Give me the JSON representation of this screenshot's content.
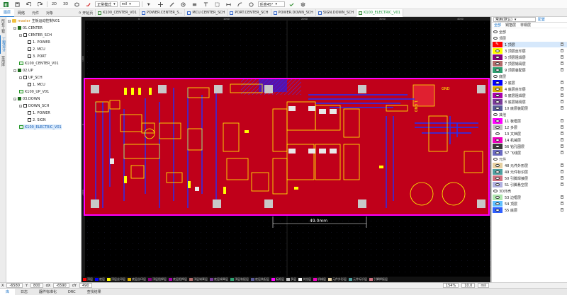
{
  "toolbar": {
    "view_2d": "2D",
    "view_3d": "3D",
    "mode_select": "正常模式",
    "unit_select": "mil",
    "angle_select": "任意45°"
  },
  "left_tabs": [
    "图层",
    "网络",
    "元件",
    "对象"
  ],
  "doc_tabs": [
    {
      "label": "开始页",
      "kind": "home"
    },
    {
      "label": "K100_CENTER_V01",
      "kind": "pcb"
    },
    {
      "label": "POWER.CENTER_S...",
      "kind": "sch"
    },
    {
      "label": "MCU.CENTER_SCH",
      "kind": "sch"
    },
    {
      "label": "PORT.CENTER_SCH",
      "kind": "sch"
    },
    {
      "label": "POWER.DOWN_SCH",
      "kind": "sch"
    },
    {
      "label": "SIGN.DOWN_SCH",
      "kind": "sch"
    },
    {
      "label": "K100_ELECTRIC_V01",
      "kind": "pcb",
      "active": true
    }
  ],
  "side_vtabs": [
    "所有工程",
    "工程设计",
    "常用库"
  ],
  "tree": [
    {
      "label": "主板运动控制V01",
      "kind": "root",
      "prefix": "master"
    },
    {
      "label": "01.CENTER",
      "kind": "board"
    },
    {
      "label": "CENTER_SCH",
      "kind": "schfolder"
    },
    {
      "label": "1. POWER",
      "kind": "page"
    },
    {
      "label": "2. MCU",
      "kind": "page"
    },
    {
      "label": "3. PORT",
      "kind": "page"
    },
    {
      "label": "K100_CENTER_V01",
      "kind": "pcb"
    },
    {
      "label": "02.UP",
      "kind": "board"
    },
    {
      "label": "UP_SCH",
      "kind": "schfolder"
    },
    {
      "label": "1. MCU",
      "kind": "page"
    },
    {
      "label": "K100_UP_V01",
      "kind": "pcb"
    },
    {
      "label": "03.DOWN",
      "kind": "board"
    },
    {
      "label": "DOWN_SCH",
      "kind": "schfolder"
    },
    {
      "label": "1. POWER",
      "kind": "page"
    },
    {
      "label": "2. SIGN",
      "kind": "page"
    },
    {
      "label": "K100_ELECTRIC_V01",
      "kind": "pcb",
      "selected": true
    }
  ],
  "layers_panel": {
    "preset": "常用(默认)",
    "manage": "配置",
    "filter_tabs": [
      "全部",
      "铜箔层",
      "非铜层"
    ],
    "group_all": "全部",
    "groups": [
      {
        "name": "顶层",
        "items": [
          {
            "name": "1 顶层",
            "color": "#ff0000",
            "selected": true
          },
          {
            "name": "3 顶层丝印层",
            "color": "#ffff00"
          },
          {
            "name": "5 顶层阻焊层",
            "color": "#8b0080"
          },
          {
            "name": "7 顶层锡膏层",
            "color": "#b36b6b"
          },
          {
            "name": "9 顶层装配层",
            "color": "#2ea070"
          }
        ]
      },
      {
        "name": "底层",
        "items": [
          {
            "name": "2 底层",
            "color": "#0000ff"
          },
          {
            "name": "4 底层丝印层",
            "color": "#d8b000"
          },
          {
            "name": "6 底层阻焊层",
            "color": "#aa00aa"
          },
          {
            "name": "8 底层锡膏层",
            "color": "#7a3a9a"
          },
          {
            "name": "10 底层装配层",
            "color": "#5a5a9a"
          }
        ]
      },
      {
        "name": "其他",
        "items": [
          {
            "name": "11 板框层",
            "color": "#ff00ff"
          },
          {
            "name": "12 多层",
            "color": "#c0c0c0"
          },
          {
            "name": "13 文档层",
            "color": "#ffffff"
          },
          {
            "name": "14 机械层",
            "color": "#f000c0"
          },
          {
            "name": "56 钻孔图层",
            "color": "#3a3a3a"
          },
          {
            "name": "57 飞线层",
            "color": "#6a6ac0"
          }
        ]
      },
      {
        "name": "元件",
        "items": [
          {
            "name": "48 元件外形层",
            "color": "#e6d0a0"
          },
          {
            "name": "49 元件标识层",
            "color": "#4ea0a0"
          },
          {
            "name": "50 引脚焊接层",
            "color": "#d07080"
          },
          {
            "name": "51 引脚悬空层",
            "color": "#b0b0e0"
          }
        ]
      },
      {
        "name": "3D外壳",
        "items": [
          {
            "name": "53 边框层",
            "color": "#b0e8b0"
          },
          {
            "name": "54 顶层",
            "color": "#60c0ff"
          },
          {
            "name": "55 底层",
            "color": "#3060ff"
          }
        ]
      }
    ]
  },
  "layer_bar": [
    {
      "name": "顶层",
      "color": "#ff0000"
    },
    {
      "name": "底层",
      "color": "#0000ff"
    },
    {
      "name": "顶层丝印层",
      "color": "#ffff00"
    },
    {
      "name": "底层丝印层",
      "color": "#d8b000"
    },
    {
      "name": "顶层阻焊层",
      "color": "#8b0080"
    },
    {
      "name": "底层阻焊层",
      "color": "#aa00aa"
    },
    {
      "name": "顶层锡膏层",
      "color": "#b36b6b"
    },
    {
      "name": "底层锡膏层",
      "color": "#7a3a9a"
    },
    {
      "name": "顶层装配层",
      "color": "#2ea070"
    },
    {
      "name": "底层装配层",
      "color": "#5a5a9a"
    },
    {
      "name": "板框层",
      "color": "#ff00ff"
    },
    {
      "name": "多层",
      "color": "#c0c0c0"
    },
    {
      "name": "文档层",
      "color": "#ffffff"
    },
    {
      "name": "机械层",
      "color": "#f000c0"
    },
    {
      "name": "元件外形层",
      "color": "#e6d0a0"
    },
    {
      "name": "元件标识层",
      "color": "#4ea0a0"
    },
    {
      "name": "引脚焊接层",
      "color": "#d07080"
    }
  ],
  "ruler": {
    "top_ticks": [
      "0",
      "1000",
      "2000",
      "3000",
      "4000"
    ],
    "left_ticks": [
      "1000",
      "0",
      "-1000"
    ]
  },
  "dimension_label": "49.0mm",
  "board_labels": {
    "gnd": "GND",
    "jumper": "1 GND"
  },
  "status": {
    "x_label": "X",
    "x_value": "-6580",
    "y_label": "Y",
    "y_value": "800",
    "dx_label": "dX",
    "dx_value": "-6590",
    "dy_label": "dY",
    "dy_value": "490",
    "zoom": "154%",
    "grid": "10.0",
    "unit": "mil"
  },
  "bottom_tabs": [
    "库",
    "日志",
    "器件标准化",
    "DRC",
    "查找结果"
  ],
  "colors": {
    "board": "#c0001a",
    "canvas": "#000000",
    "accent": "#1a73c8",
    "silk": "#ffff00"
  }
}
